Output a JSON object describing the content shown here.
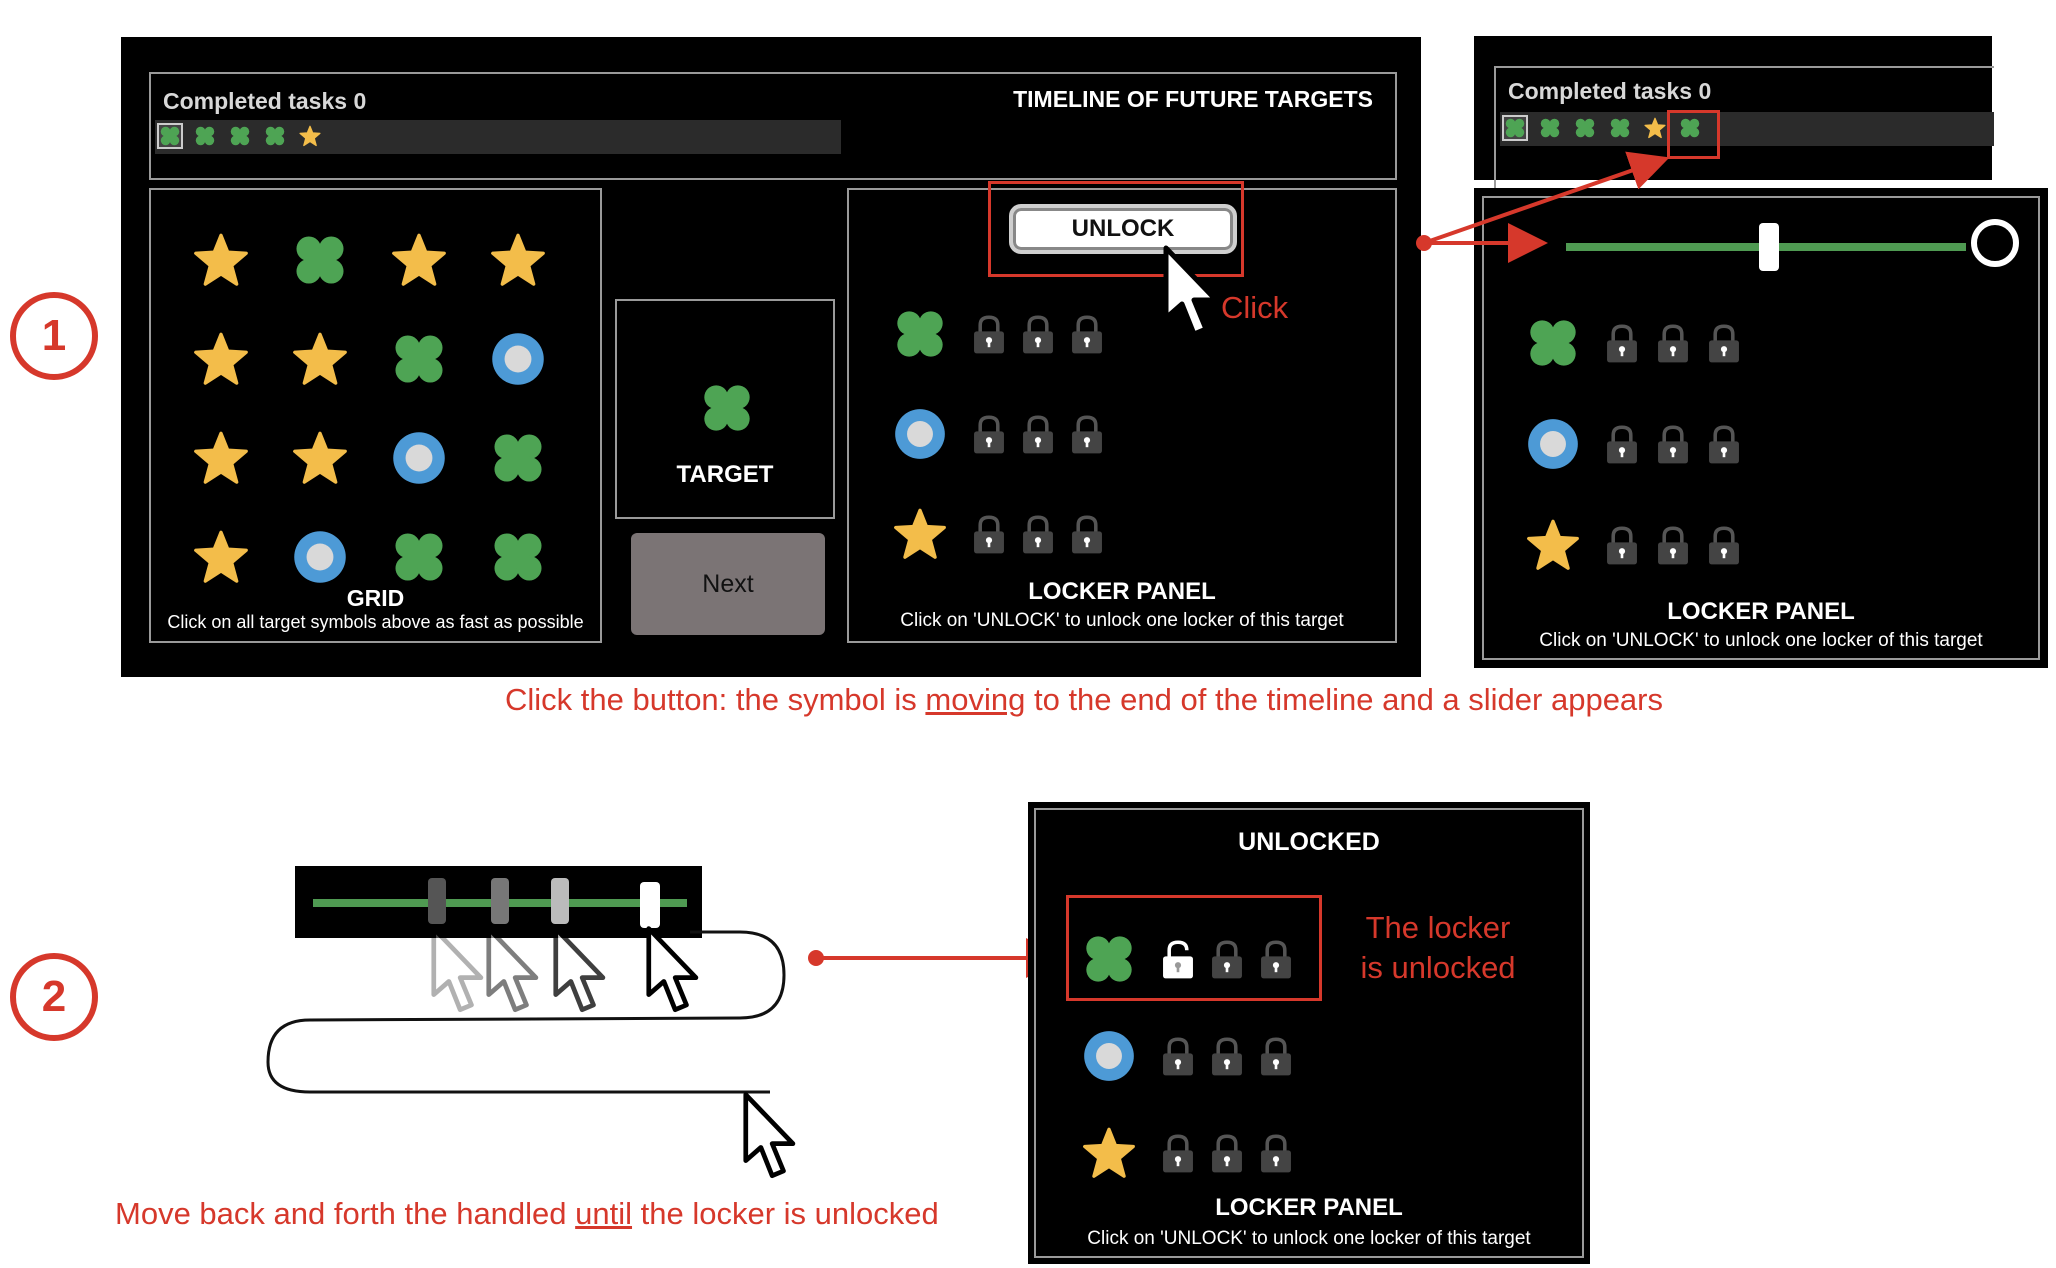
{
  "step1": {
    "number": "1"
  },
  "step2": {
    "number": "2"
  },
  "main_ui": {
    "completed_tasks": "Completed tasks 0",
    "timeline_title": "TIMELINE OF FUTURE TARGETS",
    "timeline_symbols": [
      "clover",
      "clover",
      "clover",
      "clover",
      "star"
    ],
    "grid_title": "GRID",
    "grid_instruction": "Click on all target symbols above as fast as possible",
    "grid_symbols": [
      [
        "star",
        "clover",
        "star",
        "star"
      ],
      [
        "star",
        "star",
        "clover",
        "circle"
      ],
      [
        "star",
        "star",
        "circle",
        "clover"
      ],
      [
        "star",
        "circle",
        "clover",
        "clover"
      ]
    ],
    "target_label": "TARGET",
    "target_symbol": "clover",
    "next_label": "Next",
    "unlock_label": "UNLOCK",
    "locker_title": "LOCKER PANEL",
    "locker_instruction": "Click on 'UNLOCK' to unlock one locker of this target",
    "locker_rows": [
      "clover",
      "circle",
      "star"
    ],
    "click_label": "Click"
  },
  "zoom_ui": {
    "completed_tasks": "Completed tasks 0",
    "timeline_symbols": [
      "clover",
      "clover",
      "clover",
      "clover",
      "star",
      "clover"
    ],
    "slider_value": 0.5,
    "locker_title": "LOCKER PANEL",
    "locker_instruction": "Click on 'UNLOCK' to unlock one locker of this target"
  },
  "caption1_parts": {
    "before": "Click the button: the symbol is ",
    "underlined": "moving",
    "after": " to the end of the timeline and a slider appears"
  },
  "unlocked_ui": {
    "title": "UNLOCKED",
    "locker_title": "LOCKER PANEL",
    "locker_instruction": "Click on 'UNLOCK' to unlock one locker of this target",
    "annotation": "The locker is unlocked",
    "annotation_line1": "The locker",
    "annotation_line2": "is unlocked"
  },
  "caption2_parts": {
    "before": "Move back and forth the handled ",
    "underlined": "until",
    "after": " the locker is unlocked"
  },
  "colors": {
    "annotation_red": "#d6382b",
    "star": "#f3bd4a",
    "clover": "#4ea454",
    "circle_outer": "#4d9ad6",
    "circle_inner": "#d9d9d9",
    "slider_track": "#4f9a52"
  }
}
